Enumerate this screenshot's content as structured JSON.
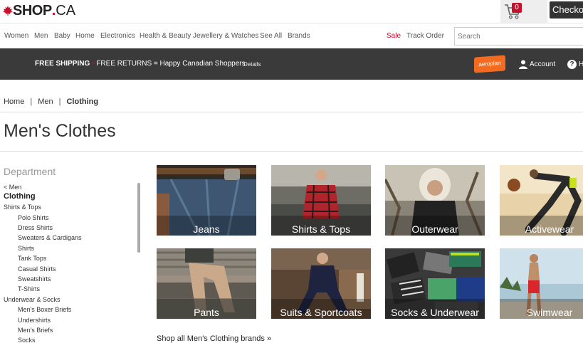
{
  "header": {
    "logo": {
      "shop": "SHOP",
      "dot": ".",
      "ca": "CA"
    },
    "cart_count": "0",
    "checkout_label": "Checkout"
  },
  "nav": {
    "items": [
      "Women",
      "Men",
      "Baby",
      "Home",
      "Electronics",
      "Health & Beauty",
      "Jewellery & Watches",
      "See All",
      "Brands"
    ],
    "sale": "Sale",
    "track_order": "Track Order",
    "search_placeholder": "Search"
  },
  "band": {
    "free_shipping": "FREE SHIPPING",
    "bullet": "•",
    "free_returns": "FREE RETURNS",
    "tagline": "= Happy Canadian Shoppers",
    "details": "Details",
    "aeroplan": "aeroplan",
    "account": "Account",
    "help": "H"
  },
  "breadcrumb": {
    "home": "Home",
    "men": "Men",
    "current": "Clothing",
    "sep": "|"
  },
  "page_title": "Men's Clothes",
  "sidebar": {
    "heading": "Department",
    "back": "< Men",
    "current": "Clothing",
    "groups": [
      {
        "label": "Shirts & Tops",
        "items": [
          "Polo Shirts",
          "Dress Shirts",
          "Sweaters & Cardigans",
          "Shirts",
          "Tank Tops",
          "Casual Shirts",
          "Sweatshirts",
          "T-Shirts"
        ]
      },
      {
        "label": "Underwear & Socks",
        "items": [
          "Men's Boxer Briefs",
          "Undershirts",
          "Men's Briefs",
          "Socks"
        ]
      }
    ]
  },
  "tiles": [
    {
      "label": "Jeans"
    },
    {
      "label": "Shirts & Tops"
    },
    {
      "label": "Outerwear"
    },
    {
      "label": "Activewear"
    },
    {
      "label": "Pants"
    },
    {
      "label": "Suits & Sportcoats"
    },
    {
      "label": "Socks & Underwear"
    },
    {
      "label": "Swimwear"
    }
  ],
  "shop_all_brands": "Shop all Men's Clothing brands »",
  "colors": {
    "brand_red": "#c8102e",
    "band": "#3a3a3a",
    "aeroplan": "#f26b21"
  }
}
